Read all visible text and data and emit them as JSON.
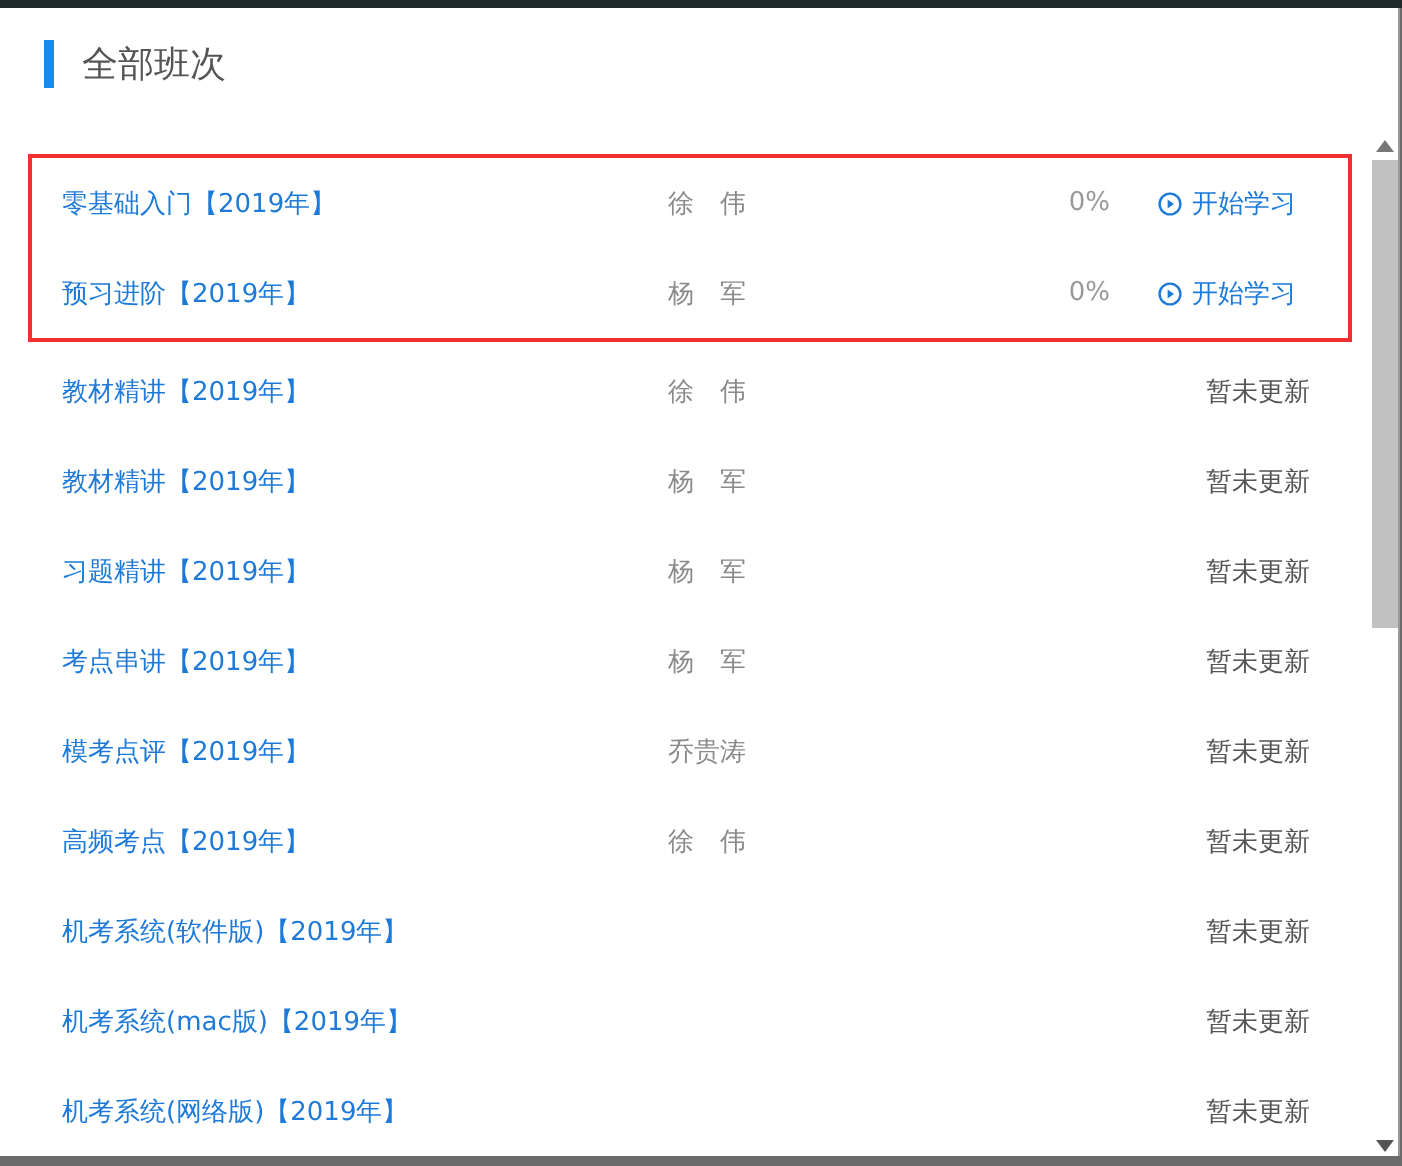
{
  "title": "全部班次",
  "highlighted_rows": [
    {
      "name": "零基础入门【2019年】",
      "teacher": "徐　伟",
      "kind": "started",
      "progress": "0%",
      "action": "开始学习"
    },
    {
      "name": "预习进阶【2019年】",
      "teacher": "杨　军",
      "kind": "started",
      "progress": "0%",
      "action": "开始学习"
    }
  ],
  "rows": [
    {
      "name": "教材精讲【2019年】",
      "teacher": "徐　伟",
      "kind": "pending",
      "status": "暂未更新"
    },
    {
      "name": "教材精讲【2019年】",
      "teacher": "杨　军",
      "kind": "pending",
      "status": "暂未更新"
    },
    {
      "name": "习题精讲【2019年】",
      "teacher": "杨　军",
      "kind": "pending",
      "status": "暂未更新"
    },
    {
      "name": "考点串讲【2019年】",
      "teacher": "杨　军",
      "kind": "pending",
      "status": "暂未更新"
    },
    {
      "name": "模考点评【2019年】",
      "teacher": "乔贵涛",
      "kind": "pending",
      "status": "暂未更新"
    },
    {
      "name": "高频考点【2019年】",
      "teacher": "徐　伟",
      "kind": "pending",
      "status": "暂未更新"
    },
    {
      "name": "机考系统(软件版)【2019年】",
      "kind": "pending",
      "status": "暂未更新"
    },
    {
      "name": "机考系统(mac版)【2019年】",
      "kind": "pending",
      "status": "暂未更新"
    },
    {
      "name": "机考系统(网络版)【2019年】",
      "kind": "pending",
      "status": "暂未更新"
    }
  ]
}
